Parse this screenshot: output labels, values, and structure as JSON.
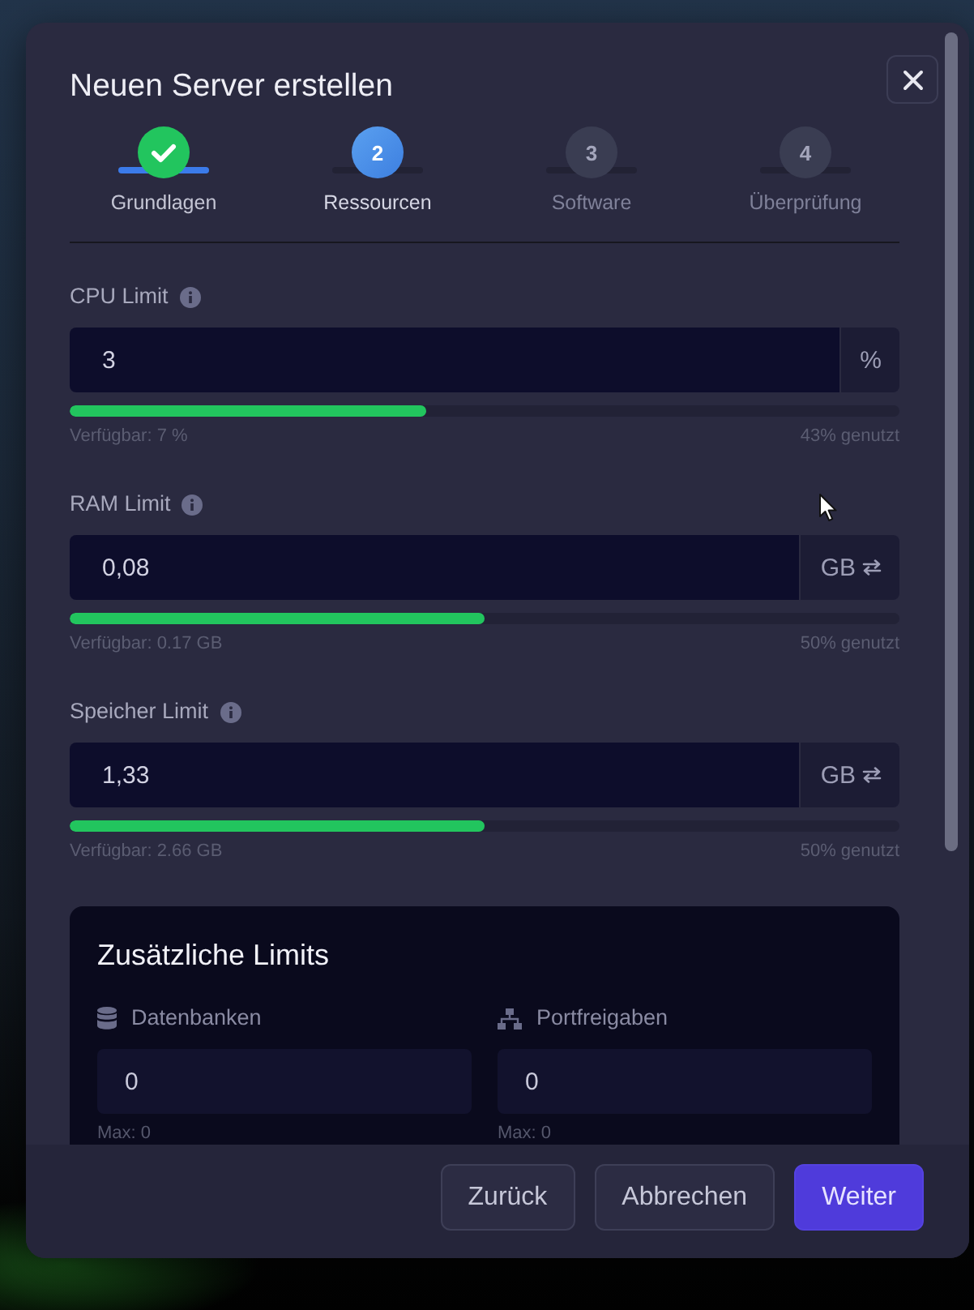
{
  "dialog": {
    "title": "Neuen Server erstellen"
  },
  "steps": [
    {
      "label": "Grundlagen",
      "completed": true,
      "selected": false
    },
    {
      "number": "2",
      "label": "Ressourcen",
      "completed": false,
      "selected": true
    },
    {
      "number": "3",
      "label": "Software",
      "completed": false,
      "selected": false
    },
    {
      "number": "4",
      "label": "Überprüfung",
      "completed": false,
      "selected": false
    }
  ],
  "resource_limits": [
    {
      "label": "CPU Limit",
      "value": "3",
      "unit": "%",
      "unit_switchable": false,
      "level": 0.43,
      "available": "Verfügbar: 7 %",
      "usage": "43% genutzt"
    },
    {
      "label": "RAM Limit",
      "value": "0,08",
      "unit": "GB",
      "unit_switchable": true,
      "level": 0.5,
      "available": "Verfügbar: 0.17 GB",
      "usage": "50% genutzt"
    },
    {
      "label": "Speicher Limit",
      "value": "1,33",
      "unit": "GB",
      "unit_switchable": true,
      "level": 0.5,
      "available": "Verfügbar: 2.66 GB",
      "usage": "50% genutzt"
    }
  ],
  "additional_limits": {
    "title": "Zusätzliche Limits",
    "fields": [
      {
        "label": "Datenbanken",
        "value": "0",
        "max": "Max: 0"
      },
      {
        "label": "Portfreigaben",
        "value": "0",
        "max": "Max: 0"
      }
    ]
  },
  "buttons": [
    {
      "label": "Zurück",
      "primary": false
    },
    {
      "label": "Abbrechen",
      "primary": false
    },
    {
      "label": "Weiter",
      "primary": true
    }
  ]
}
